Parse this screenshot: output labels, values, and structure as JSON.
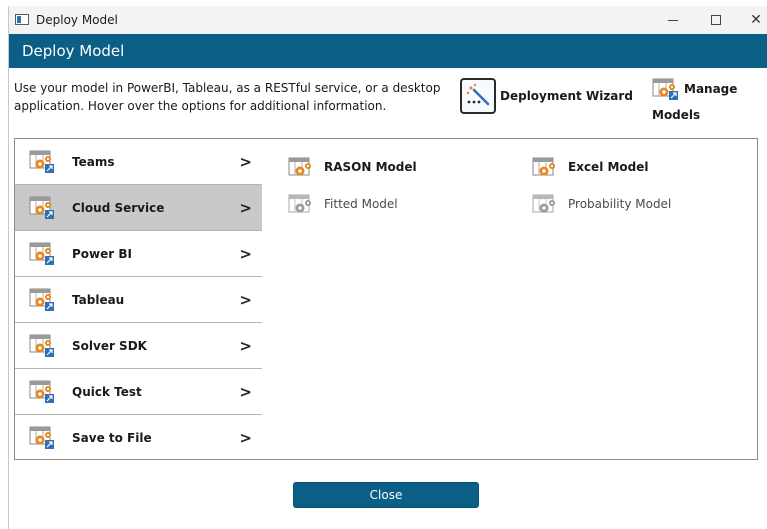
{
  "os_window": {
    "title": "Deploy Model",
    "minimize_glyph": "—",
    "maximize_glyph": "☐",
    "close_glyph": "✕"
  },
  "dialog": {
    "header_title": "Deploy Model",
    "description": "Use your model in PowerBI, Tableau, as a RESTful service, or a desktop application. Hover over the options for additional information.",
    "header_color": "#0b5f86"
  },
  "actions": {
    "wizard_label": "Deployment Wizard",
    "wizard_icon": "magic-wand-icon",
    "manage_label_line1": "Manage",
    "manage_label_line2": "Models",
    "manage_icon": "deploy-model-icon"
  },
  "nav": {
    "chevron": ">",
    "items": [
      {
        "label": "Teams",
        "selected": false
      },
      {
        "label": "Cloud Service",
        "selected": true
      },
      {
        "label": "Power BI",
        "selected": false
      },
      {
        "label": "Tableau",
        "selected": false
      },
      {
        "label": "Solver SDK",
        "selected": false
      },
      {
        "label": "Quick Test",
        "selected": false
      },
      {
        "label": "Save to File",
        "selected": false
      }
    ]
  },
  "options": {
    "rason": {
      "label": "RASON Model",
      "enabled": true
    },
    "excel": {
      "label": "Excel Model",
      "enabled": true
    },
    "fitted": {
      "label": "Fitted Model",
      "enabled": false
    },
    "probability": {
      "label": "Probability Model",
      "enabled": false
    }
  },
  "footer": {
    "close_label": "Close"
  },
  "colors": {
    "accent": "#0b5f86",
    "selected_row": "#c9c9c9",
    "icon_orange": "#e8871e",
    "icon_blue": "#2f6fb5"
  }
}
